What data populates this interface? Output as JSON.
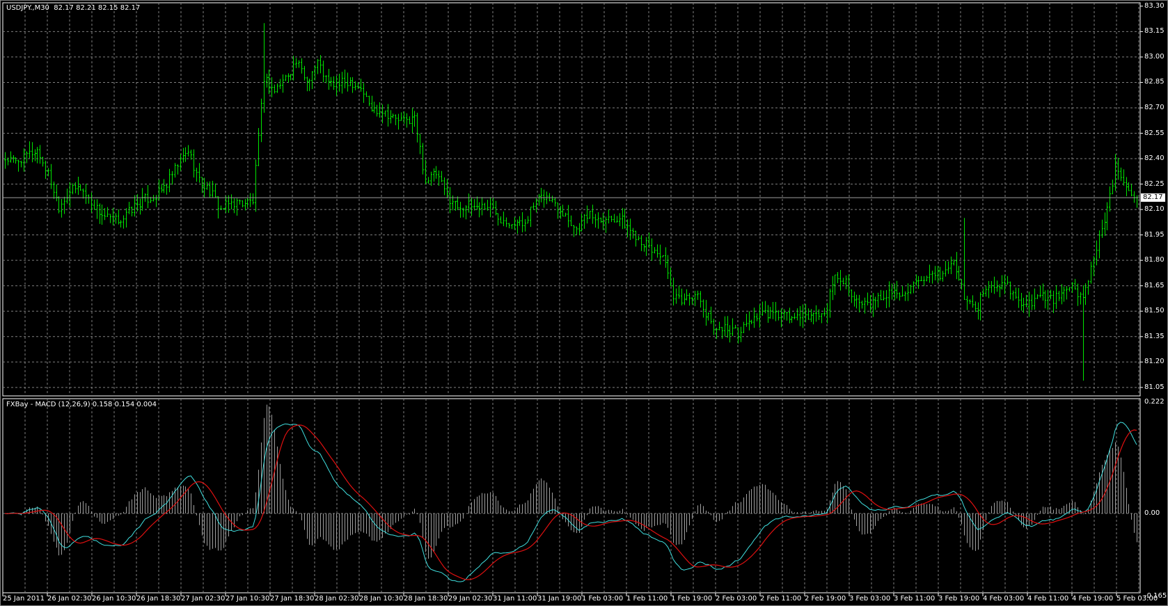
{
  "chart_data": [
    {
      "type": "ohlc",
      "title": "USDJPY.,M30",
      "ohlc_label": "82.17 82.21 82.15 82.17",
      "timeframe_minutes": 30,
      "bars_per_point": 4,
      "close_points": [
        82.4,
        82.38,
        82.42,
        82.45,
        82.31,
        82.12,
        82.21,
        82.23,
        82.14,
        82.07,
        82.03,
        82.05,
        82.12,
        82.16,
        82.18,
        82.25,
        82.36,
        82.45,
        82.27,
        82.21,
        82.1,
        82.14,
        82.14,
        82.15,
        82.88,
        82.8,
        82.88,
        82.97,
        82.86,
        82.97,
        82.84,
        82.84,
        82.86,
        82.82,
        82.69,
        82.69,
        82.64,
        82.62,
        82.64,
        82.27,
        82.31,
        82.18,
        82.12,
        82.12,
        82.12,
        82.12,
        82.05,
        82.03,
        82.01,
        82.12,
        82.18,
        82.14,
        82.07,
        81.98,
        82.07,
        82.05,
        82.05,
        82.05,
        81.98,
        81.92,
        81.86,
        81.83,
        81.57,
        81.57,
        81.61,
        81.48,
        81.4,
        81.4,
        81.37,
        81.44,
        81.48,
        81.48,
        81.48,
        81.46,
        81.46,
        81.48,
        81.48,
        81.7,
        81.68,
        81.55,
        81.53,
        81.57,
        81.61,
        81.61,
        81.64,
        81.66,
        81.7,
        81.72,
        81.79,
        81.59,
        81.5,
        81.64,
        81.64,
        81.66,
        81.55,
        81.55,
        81.59,
        81.57,
        81.59,
        81.64,
        81.57,
        81.83,
        82.01,
        82.34,
        82.25,
        82.17
      ],
      "spikes": [
        {
          "point": 24,
          "high": 83.2
        },
        {
          "point": 100,
          "low": 81.09
        },
        {
          "point": 89,
          "high": 82.05
        }
      ],
      "current_price": "82.17",
      "ylim": [
        81.0,
        83.32
      ],
      "y_ticks": [
        "83.30",
        "83.15",
        "83.00",
        "82.85",
        "82.70",
        "82.55",
        "82.40",
        "82.25",
        "82.10",
        "81.95",
        "81.80",
        "81.65",
        "81.50",
        "81.35",
        "81.20",
        "81.05"
      ],
      "bar_color": "#00e600",
      "price_line_color": "#a0a0a0"
    },
    {
      "type": "line+histogram",
      "title": "FXBay - MACD (12,26,9) 0.158 0.154 0.004",
      "params": [
        12,
        26,
        9
      ],
      "ylim": [
        -0.165,
        0.222
      ],
      "y_ticks": [
        "0.222",
        "0.00",
        "-0.165"
      ],
      "series": [
        {
          "name": "MACD",
          "color": "#40e0e0"
        },
        {
          "name": "Signal",
          "color": "#e01010"
        },
        {
          "name": "Histogram",
          "color": "#a0a0a0"
        }
      ]
    }
  ],
  "x_ticks": [
    "25 Jan 2011",
    "26 Jan 02:30",
    "26 Jan 10:30",
    "26 Jan 18:30",
    "27 Jan 02:30",
    "27 Jan 10:30",
    "27 Jan 18:30",
    "28 Jan 02:30",
    "28 Jan 10:30",
    "28 Jan 18:30",
    "29 Jan 02:30",
    "31 Jan 11:00",
    "31 Jan 19:00",
    "1 Feb 03:00",
    "1 Feb 11:00",
    "1 Feb 19:00",
    "2 Feb 03:00",
    "2 Feb 11:00",
    "2 Feb 19:00",
    "3 Feb 03:00",
    "3 Feb 11:00",
    "3 Feb 19:00",
    "4 Feb 03:00",
    "4 Feb 11:00",
    "4 Feb 19:00",
    "5 Feb 03:00"
  ]
}
